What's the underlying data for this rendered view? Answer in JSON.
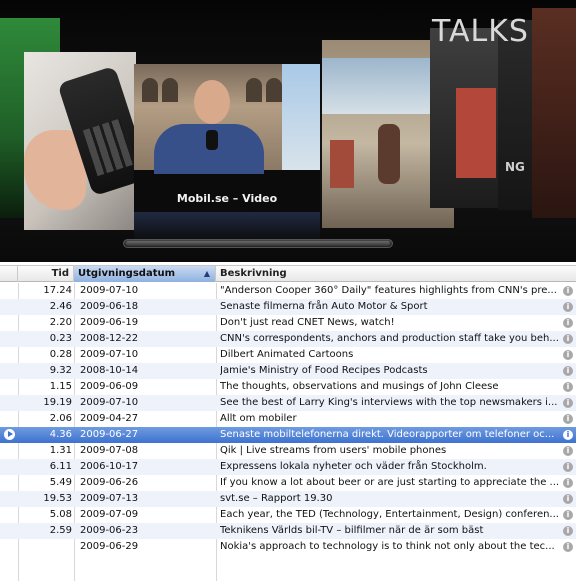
{
  "coverflow": {
    "center_title": "Mobil.se – Video",
    "right_banner_text": "TALKS",
    "right_side_text": "NG"
  },
  "table": {
    "columns": {
      "time": "Tid",
      "date": "Utgivningsdatum",
      "description": "Beskrivning"
    },
    "sort_indicator": "▲",
    "rows": [
      {
        "time": "17.24",
        "date": "2009-07-10",
        "description": "\"Anderson Cooper 360° Daily\" features highlights from CNN's pre..."
      },
      {
        "time": "2.46",
        "date": "2009-06-18",
        "description": "Senaste filmerna från Auto Motor & Sport"
      },
      {
        "time": "2.20",
        "date": "2009-06-19",
        "description": "Don't just read CNET News, watch!"
      },
      {
        "time": "0.23",
        "date": "2008-12-22",
        "description": "CNN's correspondents, anchors and production staff take you beh..."
      },
      {
        "time": "0.28",
        "date": "2009-07-10",
        "description": "Dilbert Animated Cartoons"
      },
      {
        "time": "9.32",
        "date": "2008-10-14",
        "description": "Jamie's Ministry of Food Recipes Podcasts"
      },
      {
        "time": "1.15",
        "date": "2009-06-09",
        "description": "The thoughts, observations and musings of John Cleese"
      },
      {
        "time": "19.19",
        "date": "2009-07-10",
        "description": "See the best of Larry King's interviews with the top newsmakers i..."
      },
      {
        "time": "2.06",
        "date": "2009-04-27",
        "description": "Allt om mobiler"
      },
      {
        "time": "4.36",
        "date": "2009-06-27",
        "description": "Senaste mobiltelefonerna direkt. Videorapporter om telefoner oc...",
        "selected": true
      },
      {
        "time": "1.31",
        "date": "2009-07-08",
        "description": "Qik | Live streams from users' mobile phones"
      },
      {
        "time": "6.11",
        "date": "2006-10-17",
        "description": "Expressens lokala nyheter och väder från Stockholm."
      },
      {
        "time": "5.49",
        "date": "2009-06-26",
        "description": "If you know a lot about beer or are just starting to appreciate the ..."
      },
      {
        "time": "19.53",
        "date": "2009-07-13",
        "description": "svt.se – Rapport 19.30"
      },
      {
        "time": "5.08",
        "date": "2009-07-09",
        "description": "Each year, the TED (Technology, Entertainment, Design) conferen..."
      },
      {
        "time": "2.59",
        "date": "2009-06-23",
        "description": "Teknikens Världs bil-TV – bilfilmer när de är som bäst"
      },
      {
        "time": "",
        "date": "2009-06-29",
        "description": "Nokia's approach to technology is to think not only about the tec..."
      }
    ]
  },
  "icons": {
    "info": "info-icon",
    "play": "play-icon"
  }
}
